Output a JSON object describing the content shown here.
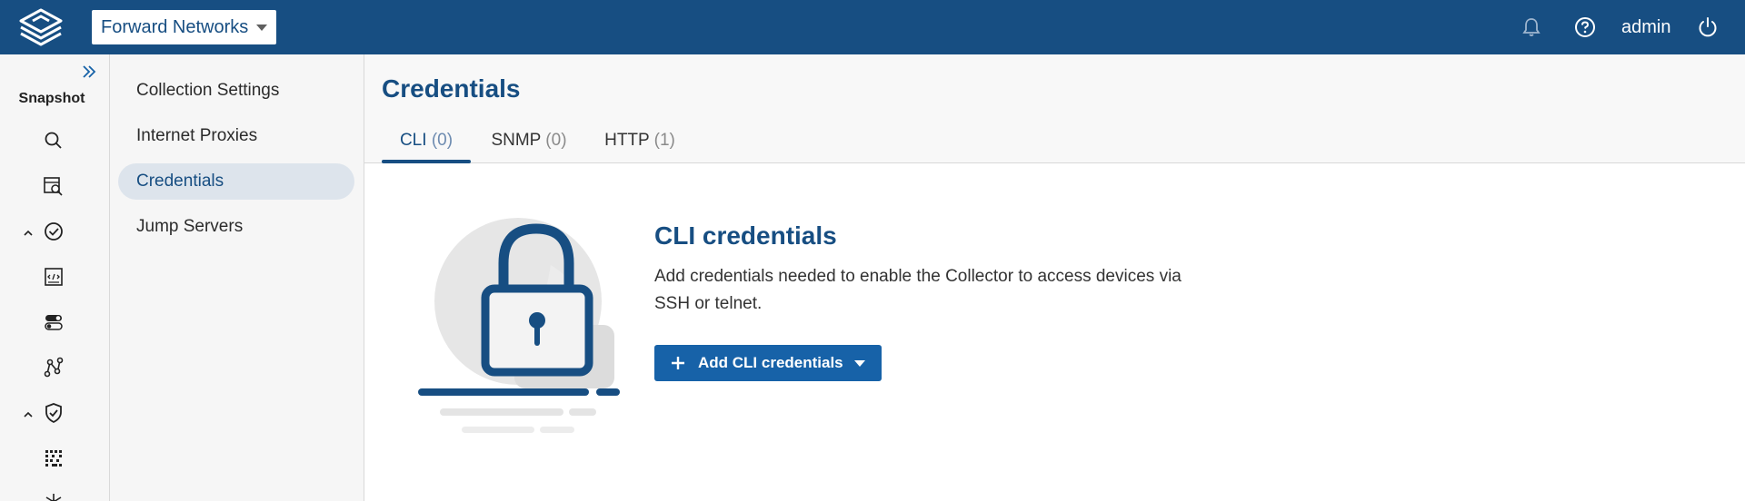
{
  "topbar": {
    "org_select": "Forward Networks",
    "user": "admin",
    "icons": [
      "logo-icon",
      "bell-icon",
      "help-icon",
      "power-icon"
    ]
  },
  "rail": {
    "title": "Snapshot",
    "icons": [
      "expand-icon",
      "search-icon",
      "device-search-icon",
      "check-circle-icon",
      "code-icon",
      "toggle-icon",
      "path-icon",
      "shield-check-icon",
      "grid-icon",
      "network-icon"
    ]
  },
  "subnav": {
    "items": [
      {
        "label": "Collection Settings"
      },
      {
        "label": "Internet Proxies"
      },
      {
        "label": "Credentials"
      },
      {
        "label": "Jump Servers"
      }
    ],
    "active_index": 2
  },
  "main": {
    "title": "Credentials",
    "tabs": [
      {
        "label": "CLI",
        "count": "(0)"
      },
      {
        "label": "SNMP",
        "count": "(0)"
      },
      {
        "label": "HTTP",
        "count": "(1)"
      }
    ],
    "active_tab": 0
  },
  "empty_state": {
    "illustration": "lock-icon",
    "title": "CLI credentials",
    "description": "Add credentials needed to enable the Collector to access devices via SSH or telnet.",
    "button_label": "Add CLI credentials"
  },
  "colors": {
    "brand": "#174e82",
    "button": "#1762a8",
    "active_nav_bg": "#dde4ec"
  }
}
